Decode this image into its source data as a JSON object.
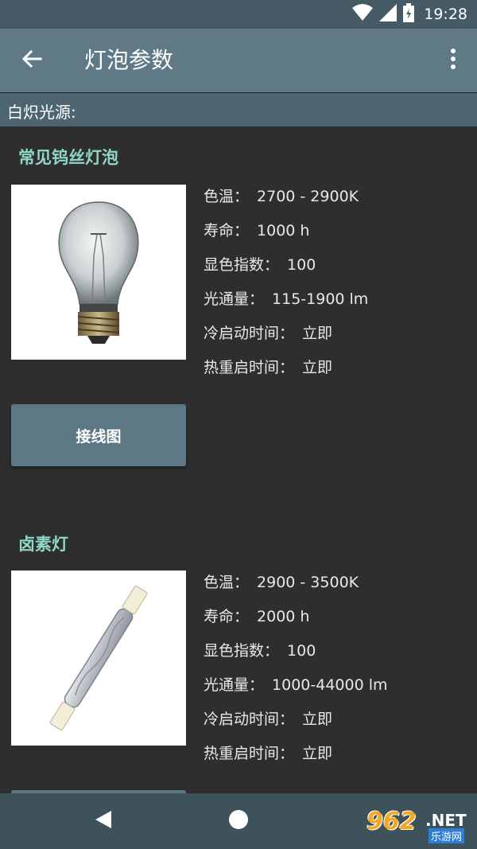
{
  "status_bar": {
    "time": "19:28"
  },
  "app_bar": {
    "title": "灯泡参数"
  },
  "section": {
    "label": "白炽光源:"
  },
  "items": [
    {
      "title": "常见钨丝灯泡",
      "image": "incandescent-bulb",
      "specs": [
        {
          "label": "色温：",
          "value": "2700 - 2900K"
        },
        {
          "label": "寿命：",
          "value": "1000 h"
        },
        {
          "label": "显色指数：",
          "value": "100"
        },
        {
          "label": "光通量：",
          "value": "115-1900 lm"
        },
        {
          "label": "冷启动时间：",
          "value": "立即"
        },
        {
          "label": "热重启时间：",
          "value": "立即"
        }
      ],
      "button": "接线图"
    },
    {
      "title": "卤素灯",
      "image": "halogen-tube",
      "specs": [
        {
          "label": "色温：",
          "value": "2900 - 3500K"
        },
        {
          "label": "寿命：",
          "value": "2000 h"
        },
        {
          "label": "显色指数：",
          "value": "100"
        },
        {
          "label": "光通量：",
          "value": "1000-44000 lm"
        },
        {
          "label": "冷启动时间：",
          "value": "立即"
        },
        {
          "label": "热重启时间：",
          "value": "立即"
        }
      ]
    }
  ],
  "watermark": {
    "brand": "962",
    "suffix": ".NET",
    "site": "乐游网"
  },
  "colors": {
    "app_bar": "#5f7a86",
    "status_bar": "#455a64",
    "accent_title": "#8fd6c5",
    "background": "#2e2e2e",
    "button": "#5d7785"
  }
}
